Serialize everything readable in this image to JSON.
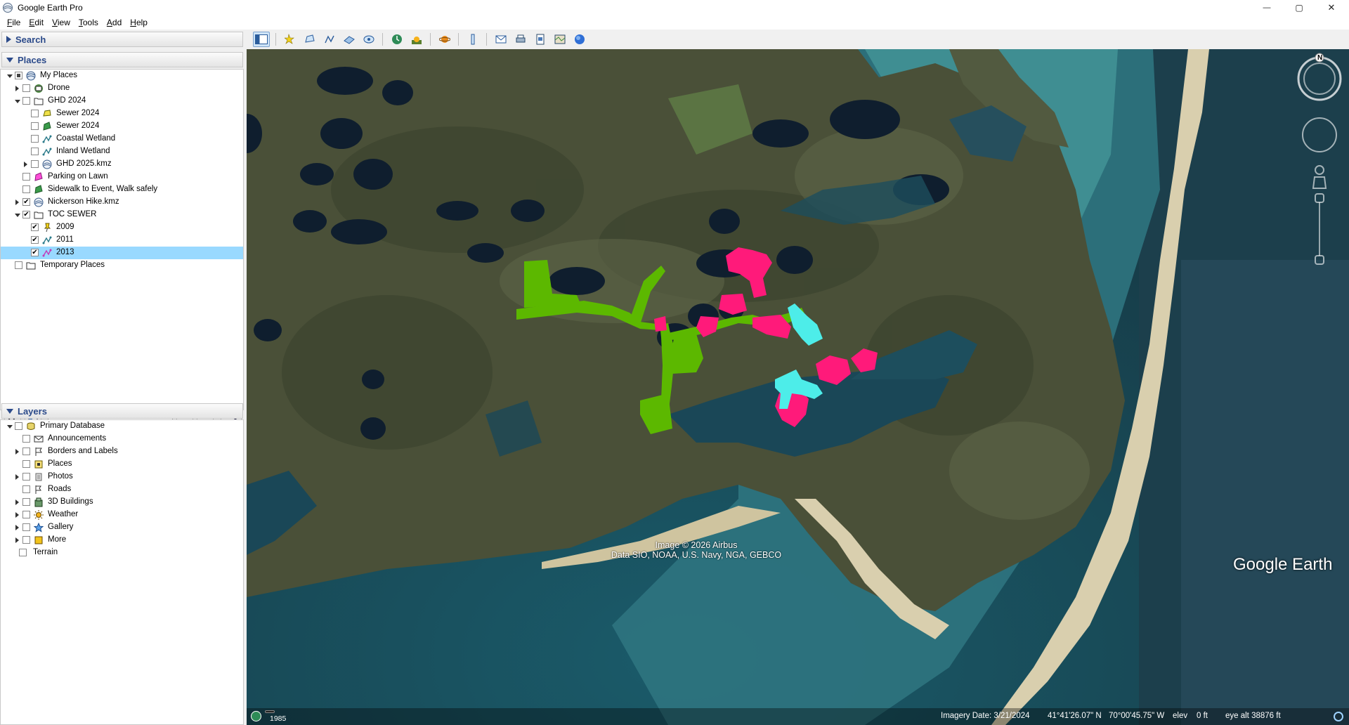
{
  "window": {
    "title": "Google Earth Pro",
    "minimize": "—",
    "maximize": "▢",
    "close": "✕"
  },
  "menu": [
    {
      "key": "F",
      "rest": "ile"
    },
    {
      "key": "E",
      "rest": "dit"
    },
    {
      "key": "V",
      "rest": "iew"
    },
    {
      "key": "T",
      "rest": "ools"
    },
    {
      "key": "A",
      "rest": "dd"
    },
    {
      "key": "H",
      "rest": "elp"
    }
  ],
  "search": {
    "header": "Search"
  },
  "places": {
    "header": "Places",
    "items": [
      {
        "label": "My Places",
        "checked": "part",
        "icon": "globe-icon"
      },
      {
        "label": "Drone",
        "checked": "no",
        "icon": "network-link-icon"
      },
      {
        "label": "GHD 2024",
        "checked": "no",
        "icon": "folder-icon"
      },
      {
        "label": "Sewer 2024",
        "checked": "no",
        "icon": "polygon-yellow-icon"
      },
      {
        "label": "Sewer 2024",
        "checked": "no",
        "icon": "polygon-green-icon"
      },
      {
        "label": "Coastal Wetland",
        "checked": "no",
        "icon": "path-icon"
      },
      {
        "label": "Inland Wetland",
        "checked": "no",
        "icon": "path-icon"
      },
      {
        "label": "GHD 2025.kmz",
        "checked": "no",
        "icon": "kmz-icon"
      },
      {
        "label": "Parking on Lawn",
        "checked": "no",
        "icon": "polygon-pink-icon"
      },
      {
        "label": "Sidewalk to Event, Walk safely",
        "checked": "no",
        "icon": "polygon-green-icon"
      },
      {
        "label": "Nickerson Hike.kmz",
        "checked": "yes",
        "icon": "kmz-icon"
      },
      {
        "label": "TOC SEWER",
        "checked": "yes",
        "icon": "folder-icon"
      },
      {
        "label": "2009",
        "checked": "yes",
        "icon": "pushpin-icon"
      },
      {
        "label": "2011",
        "checked": "yes",
        "icon": "path-icon"
      },
      {
        "label": "2013",
        "checked": "yes",
        "icon": "path-pink-icon"
      },
      {
        "label": "Temporary Places",
        "checked": "no",
        "icon": "folder-icon"
      }
    ]
  },
  "layers": {
    "header": "Layers",
    "items": [
      {
        "label": "Primary Database",
        "checked": "no",
        "icon": "database-icon"
      },
      {
        "label": "Announcements",
        "checked": "no",
        "icon": "envelope-icon"
      },
      {
        "label": "Borders and Labels",
        "checked": "no",
        "icon": "flag-icon"
      },
      {
        "label": "Places",
        "checked": "no",
        "icon": "places-icon"
      },
      {
        "label": "Photos",
        "checked": "no",
        "icon": "photo-icon"
      },
      {
        "label": "Roads",
        "checked": "no",
        "icon": "road-icon"
      },
      {
        "label": "3D Buildings",
        "checked": "no",
        "icon": "building-icon"
      },
      {
        "label": "Weather",
        "checked": "no",
        "icon": "sun-icon"
      },
      {
        "label": "Gallery",
        "checked": "no",
        "icon": "star-icon"
      },
      {
        "label": "More",
        "checked": "no",
        "icon": "more-icon"
      },
      {
        "label": "Terrain",
        "checked": "no",
        "icon": ""
      }
    ]
  },
  "map": {
    "attribution_line1": "Image © 2026 Airbus",
    "attribution_line2": "Data SIO, NOAA, U.S. Navy, NGA, GEBCO",
    "logo": "Google Earth",
    "compass_letter": "N",
    "historical_year": "1985"
  },
  "status": {
    "imagery_date": "Imagery Date: 3/21/2024",
    "lat": "41°41'26.07\" N",
    "lon": "70°00'45.75\" W",
    "elev_label": "elev",
    "elev_value": "0 ft",
    "eye_alt": "eye alt  38876 ft"
  },
  "colors": {
    "overlay_green": "#5cb800",
    "overlay_pink": "#ff1a7a",
    "overlay_cyan": "#4dede9",
    "selection": "#99d9ff"
  }
}
